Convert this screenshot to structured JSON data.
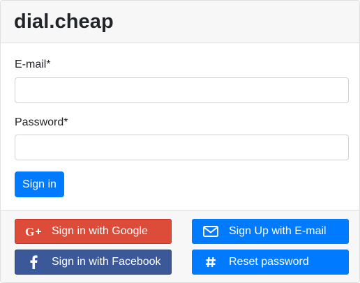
{
  "header": {
    "brand": "dial.cheap"
  },
  "form": {
    "email_label": "E-mail*",
    "email_value": "",
    "password_label": "Password*",
    "password_value": "",
    "signin_label": "Sign in"
  },
  "social": {
    "google_label": "Sign in with Google",
    "facebook_label": "Sign in with Facebook",
    "email_signup_label": "Sign Up with E-mail",
    "reset_label": "Reset password",
    "google_icon": "google-plus-icon",
    "facebook_icon": "facebook-icon",
    "envelope_icon": "envelope-icon",
    "hashtag_icon": "hashtag-icon"
  },
  "colors": {
    "primary": "#007bff",
    "google": "#dd4b39",
    "facebook": "#3b5998",
    "header_bg": "#f7f7f7"
  }
}
